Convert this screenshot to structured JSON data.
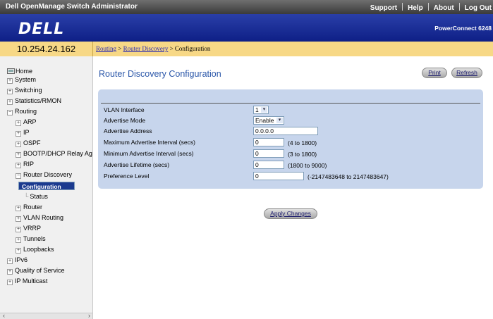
{
  "titlebar": {
    "app_title": "Dell OpenManage Switch Administrator",
    "links": [
      "Support",
      "Help",
      "About",
      "Log Out"
    ]
  },
  "brand": {
    "logo": "DELL",
    "product": "PowerConnect 6248"
  },
  "switch_ip": "10.254.24.162",
  "breadcrumb": {
    "level1": "Routing",
    "sep": " > ",
    "level2": "Router Discovery",
    "current": "Configuration"
  },
  "nav": {
    "items": [
      {
        "label": "Home",
        "toggle": "",
        "icon": "home-icon"
      },
      {
        "label": "System",
        "toggle": "+"
      },
      {
        "label": "Switching",
        "toggle": "+"
      },
      {
        "label": "Statistics/RMON",
        "toggle": "+"
      },
      {
        "label": "Routing",
        "toggle": "−"
      },
      {
        "label": "ARP",
        "toggle": "+"
      },
      {
        "label": "IP",
        "toggle": "+"
      },
      {
        "label": "OSPF",
        "toggle": "+"
      },
      {
        "label": "BOOTP/DHCP Relay Agent",
        "toggle": "+"
      },
      {
        "label": "RIP",
        "toggle": "+"
      },
      {
        "label": "Router Discovery",
        "toggle": "−"
      },
      {
        "label": "Configuration",
        "toggle": ""
      },
      {
        "label": "Status",
        "toggle": ""
      },
      {
        "label": "Router",
        "toggle": "+"
      },
      {
        "label": "VLAN Routing",
        "toggle": "+"
      },
      {
        "label": "VRRP",
        "toggle": "+"
      },
      {
        "label": "Tunnels",
        "toggle": "+"
      },
      {
        "label": "Loopbacks",
        "toggle": "+"
      },
      {
        "label": "IPv6",
        "toggle": "+"
      },
      {
        "label": "Quality of Service",
        "toggle": "+"
      },
      {
        "label": "IP Multicast",
        "toggle": "+"
      }
    ]
  },
  "page": {
    "title": "Router Discovery Configuration",
    "print_label": "Print",
    "refresh_label": "Refresh",
    "apply_label": "Apply Changes"
  },
  "form": {
    "vlan_interface": {
      "label": "VLAN Interface",
      "value": "1"
    },
    "advertise_mode": {
      "label": "Advertise Mode",
      "value": "Enable"
    },
    "advertise_address": {
      "label": "Advertise Address",
      "value": "0.0.0.0"
    },
    "max_interval": {
      "label": "Maximum Advertise Interval (secs)",
      "value": "0",
      "hint": "(4 to 1800)"
    },
    "min_interval": {
      "label": "Minimum Advertise Interval (secs)",
      "value": "0",
      "hint": "(3 to 1800)"
    },
    "lifetime": {
      "label": "Advertise Lifetime (secs)",
      "value": "0",
      "hint": "(1800 to 9000)"
    },
    "preference": {
      "label": "Preference Level",
      "value": "0",
      "hint": "(-2147483648 to 2147483647)"
    }
  },
  "colors": {
    "brand_blue": "#0e1f86",
    "title_blue": "#2b57a9",
    "ip_bar": "#f7d886",
    "panel": "#c7d5ec",
    "nav_selected": "#1b3a8f"
  }
}
